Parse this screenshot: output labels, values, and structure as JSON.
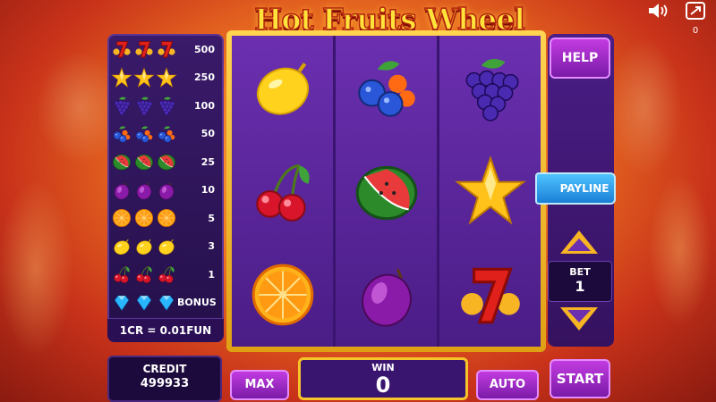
{
  "game": {
    "title": "Hot Fruits Wheel"
  },
  "top_icons": {
    "sound_icon": "speaker-icon",
    "fullscreen_icon": "fullscreen-icon",
    "fullscreen_count": "0"
  },
  "paytable": {
    "rows": [
      {
        "symbol": "seven",
        "payout": "500"
      },
      {
        "symbol": "star",
        "payout": "250"
      },
      {
        "symbol": "grapes",
        "payout": "100"
      },
      {
        "symbol": "mixed-berries",
        "payout": "50"
      },
      {
        "symbol": "watermelon",
        "payout": "25"
      },
      {
        "symbol": "plum",
        "payout": "10"
      },
      {
        "symbol": "orange",
        "payout": "5"
      },
      {
        "symbol": "lemon",
        "payout": "3"
      },
      {
        "symbol": "cherry",
        "payout": "1"
      },
      {
        "symbol": "diamond",
        "payout": "BONUS"
      }
    ],
    "credit_rate": "1CR = 0.01FUN"
  },
  "reels": [
    [
      "lemon",
      "cherry",
      "orange"
    ],
    [
      "mixed-berries",
      "watermelon",
      "plum"
    ],
    [
      "grapes",
      "star",
      "seven"
    ]
  ],
  "controls": {
    "help_label": "HELP",
    "payline_label": "PAYLINE",
    "bet_label": "BET",
    "bet_value": "1",
    "start_label": "START",
    "max_label": "MAX",
    "auto_label": "AUTO"
  },
  "status": {
    "credit_label": "CREDIT",
    "credit_value": "499933",
    "win_label": "WIN",
    "win_value": "0"
  },
  "colors": {
    "frame_gold": "#f7c42a",
    "panel_purple": "#4a1d86",
    "button_magenta": "#b030d8",
    "payline_blue": "#2c95e6"
  }
}
